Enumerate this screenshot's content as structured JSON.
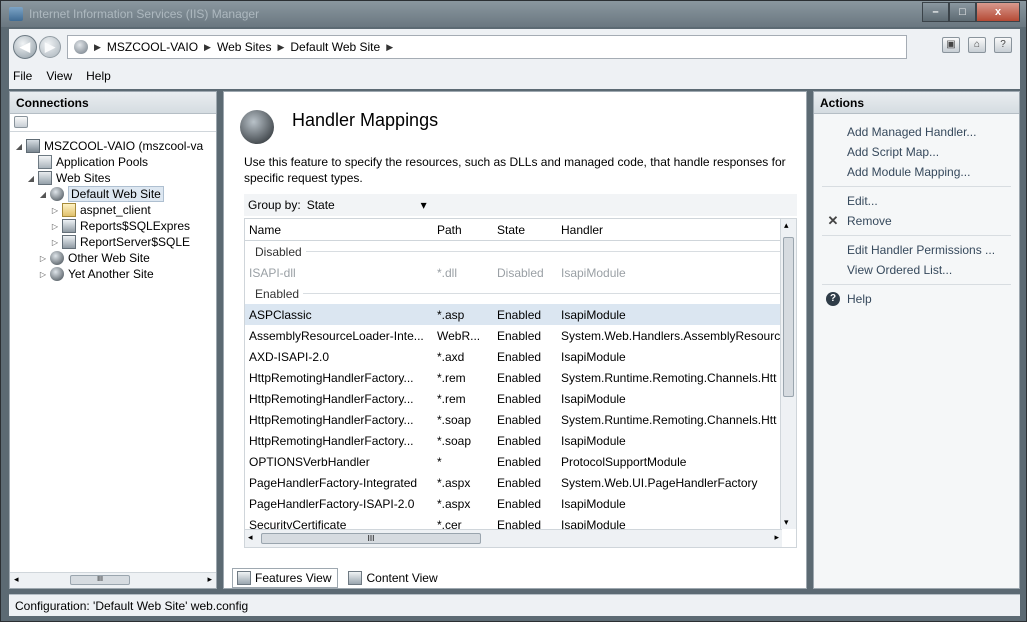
{
  "window": {
    "title": "Internet Information Services (IIS) Manager",
    "controls": {
      "minimize": "–",
      "maximize": "□",
      "close": "x"
    }
  },
  "address": {
    "crumbs": [
      "MSZCOOL-VAIO",
      "Web Sites",
      "Default Web Site"
    ]
  },
  "menu": [
    "File",
    "View",
    "Help"
  ],
  "connections": {
    "title": "Connections",
    "tree": [
      {
        "label": "MSZCOOL-VAIO (mszcool-va",
        "icon": "server-icon",
        "indent": 0,
        "expander": "◢"
      },
      {
        "label": "Application Pools",
        "icon": "pool-icon",
        "indent": 1,
        "expander": ""
      },
      {
        "label": "Web Sites",
        "icon": "sites-icon",
        "indent": 1,
        "expander": "◢"
      },
      {
        "label": "Default Web Site",
        "icon": "site-icon",
        "indent": 2,
        "expander": "◢",
        "selected": true
      },
      {
        "label": "aspnet_client",
        "icon": "folder-icon",
        "indent": 3,
        "expander": "▷"
      },
      {
        "label": "Reports$SQLExpres",
        "icon": "app-icon",
        "indent": 3,
        "expander": "▷"
      },
      {
        "label": "ReportServer$SQLE",
        "icon": "app-icon",
        "indent": 3,
        "expander": "▷"
      },
      {
        "label": "Other Web Site",
        "icon": "site-icon",
        "indent": 2,
        "expander": "▷"
      },
      {
        "label": "Yet Another Site",
        "icon": "site-icon",
        "indent": 2,
        "expander": "▷"
      }
    ]
  },
  "center": {
    "title": "Handler Mappings",
    "description": "Use this feature to specify the resources, such as DLLs and managed code, that handle responses for specific request types.",
    "group_by_label": "Group by:",
    "group_by_value": "State",
    "columns": [
      "Name",
      "Path",
      "State",
      "Handler"
    ],
    "groups": [
      {
        "name": "Disabled",
        "rows": [
          {
            "name": "ISAPI-dll",
            "path": "*.dll",
            "state": "Disabled",
            "handler": "IsapiModule",
            "disabled": true
          }
        ]
      },
      {
        "name": "Enabled",
        "rows": [
          {
            "name": "ASPClassic",
            "path": "*.asp",
            "state": "Enabled",
            "handler": "IsapiModule",
            "selected": true
          },
          {
            "name": "AssemblyResourceLoader-Inte...",
            "path": "WebR...",
            "state": "Enabled",
            "handler": "System.Web.Handlers.AssemblyResourceL"
          },
          {
            "name": "AXD-ISAPI-2.0",
            "path": "*.axd",
            "state": "Enabled",
            "handler": "IsapiModule"
          },
          {
            "name": "HttpRemotingHandlerFactory...",
            "path": "*.rem",
            "state": "Enabled",
            "handler": "System.Runtime.Remoting.Channels.Htt"
          },
          {
            "name": "HttpRemotingHandlerFactory...",
            "path": "*.rem",
            "state": "Enabled",
            "handler": "IsapiModule"
          },
          {
            "name": "HttpRemotingHandlerFactory...",
            "path": "*.soap",
            "state": "Enabled",
            "handler": "System.Runtime.Remoting.Channels.Htt"
          },
          {
            "name": "HttpRemotingHandlerFactory...",
            "path": "*.soap",
            "state": "Enabled",
            "handler": "IsapiModule"
          },
          {
            "name": "OPTIONSVerbHandler",
            "path": "*",
            "state": "Enabled",
            "handler": "ProtocolSupportModule"
          },
          {
            "name": "PageHandlerFactory-Integrated",
            "path": "*.aspx",
            "state": "Enabled",
            "handler": "System.Web.UI.PageHandlerFactory"
          },
          {
            "name": "PageHandlerFactory-ISAPI-2.0",
            "path": "*.aspx",
            "state": "Enabled",
            "handler": "IsapiModule"
          },
          {
            "name": "SecurityCertificate",
            "path": "*.cer",
            "state": "Enabled",
            "handler": "IsapiModule"
          }
        ]
      }
    ],
    "view_tabs": [
      "Features View",
      "Content View"
    ]
  },
  "actions": {
    "title": "Actions",
    "items": [
      {
        "label": "Add Managed Handler...",
        "icon": ""
      },
      {
        "label": "Add Script Map...",
        "icon": ""
      },
      {
        "label": "Add Module Mapping...",
        "icon": ""
      },
      {
        "label": "Edit...",
        "icon": "",
        "gap": true
      },
      {
        "label": "Remove",
        "icon": "remove-icon"
      },
      {
        "label": "Edit Handler Permissions ...",
        "icon": "",
        "gap": true
      },
      {
        "label": "View Ordered List...",
        "icon": ""
      },
      {
        "label": "Help",
        "icon": "help-icon",
        "gap": true
      }
    ]
  },
  "status": {
    "text": "Configuration: 'Default Web Site' web.config"
  },
  "scroll_glyphs": {
    "left": "◂",
    "right": "▸",
    "up": "▴",
    "down": "▾",
    "grip": "III"
  }
}
